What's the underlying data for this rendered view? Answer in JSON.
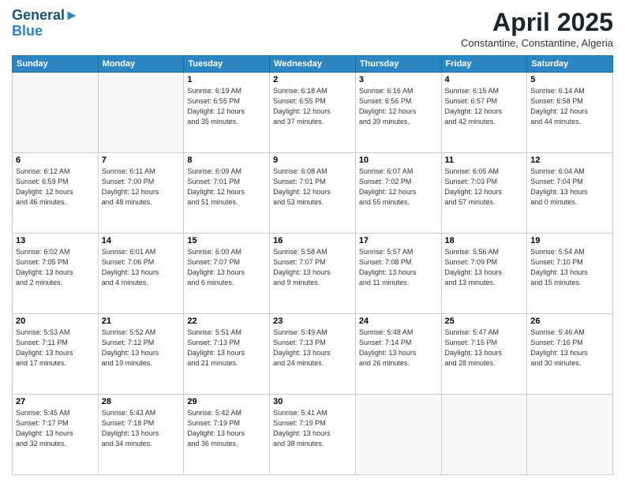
{
  "header": {
    "logo_line1": "General",
    "logo_line2": "Blue",
    "month": "April 2025",
    "location": "Constantine, Constantine, Algeria"
  },
  "days_of_week": [
    "Sunday",
    "Monday",
    "Tuesday",
    "Wednesday",
    "Thursday",
    "Friday",
    "Saturday"
  ],
  "weeks": [
    [
      {
        "day": "",
        "info": ""
      },
      {
        "day": "",
        "info": ""
      },
      {
        "day": "1",
        "info": "Sunrise: 6:19 AM\nSunset: 6:55 PM\nDaylight: 12 hours\nand 35 minutes."
      },
      {
        "day": "2",
        "info": "Sunrise: 6:18 AM\nSunset: 6:55 PM\nDaylight: 12 hours\nand 37 minutes."
      },
      {
        "day": "3",
        "info": "Sunrise: 6:16 AM\nSunset: 6:56 PM\nDaylight: 12 hours\nand 39 minutes."
      },
      {
        "day": "4",
        "info": "Sunrise: 6:15 AM\nSunset: 6:57 PM\nDaylight: 12 hours\nand 42 minutes."
      },
      {
        "day": "5",
        "info": "Sunrise: 6:14 AM\nSunset: 6:58 PM\nDaylight: 12 hours\nand 44 minutes."
      }
    ],
    [
      {
        "day": "6",
        "info": "Sunrise: 6:12 AM\nSunset: 6:59 PM\nDaylight: 12 hours\nand 46 minutes."
      },
      {
        "day": "7",
        "info": "Sunrise: 6:11 AM\nSunset: 7:00 PM\nDaylight: 12 hours\nand 48 minutes."
      },
      {
        "day": "8",
        "info": "Sunrise: 6:09 AM\nSunset: 7:01 PM\nDaylight: 12 hours\nand 51 minutes."
      },
      {
        "day": "9",
        "info": "Sunrise: 6:08 AM\nSunset: 7:01 PM\nDaylight: 12 hours\nand 53 minutes."
      },
      {
        "day": "10",
        "info": "Sunrise: 6:07 AM\nSunset: 7:02 PM\nDaylight: 12 hours\nand 55 minutes."
      },
      {
        "day": "11",
        "info": "Sunrise: 6:05 AM\nSunset: 7:03 PM\nDaylight: 12 hours\nand 57 minutes."
      },
      {
        "day": "12",
        "info": "Sunrise: 6:04 AM\nSunset: 7:04 PM\nDaylight: 13 hours\nand 0 minutes."
      }
    ],
    [
      {
        "day": "13",
        "info": "Sunrise: 6:02 AM\nSunset: 7:05 PM\nDaylight: 13 hours\nand 2 minutes."
      },
      {
        "day": "14",
        "info": "Sunrise: 6:01 AM\nSunset: 7:06 PM\nDaylight: 13 hours\nand 4 minutes."
      },
      {
        "day": "15",
        "info": "Sunrise: 6:00 AM\nSunset: 7:07 PM\nDaylight: 13 hours\nand 6 minutes."
      },
      {
        "day": "16",
        "info": "Sunrise: 5:58 AM\nSunset: 7:07 PM\nDaylight: 13 hours\nand 9 minutes."
      },
      {
        "day": "17",
        "info": "Sunrise: 5:57 AM\nSunset: 7:08 PM\nDaylight: 13 hours\nand 11 minutes."
      },
      {
        "day": "18",
        "info": "Sunrise: 5:56 AM\nSunset: 7:09 PM\nDaylight: 13 hours\nand 13 minutes."
      },
      {
        "day": "19",
        "info": "Sunrise: 5:54 AM\nSunset: 7:10 PM\nDaylight: 13 hours\nand 15 minutes."
      }
    ],
    [
      {
        "day": "20",
        "info": "Sunrise: 5:53 AM\nSunset: 7:11 PM\nDaylight: 13 hours\nand 17 minutes."
      },
      {
        "day": "21",
        "info": "Sunrise: 5:52 AM\nSunset: 7:12 PM\nDaylight: 13 hours\nand 19 minutes."
      },
      {
        "day": "22",
        "info": "Sunrise: 5:51 AM\nSunset: 7:13 PM\nDaylight: 13 hours\nand 21 minutes."
      },
      {
        "day": "23",
        "info": "Sunrise: 5:49 AM\nSunset: 7:13 PM\nDaylight: 13 hours\nand 24 minutes."
      },
      {
        "day": "24",
        "info": "Sunrise: 5:48 AM\nSunset: 7:14 PM\nDaylight: 13 hours\nand 26 minutes."
      },
      {
        "day": "25",
        "info": "Sunrise: 5:47 AM\nSunset: 7:15 PM\nDaylight: 13 hours\nand 28 minutes."
      },
      {
        "day": "26",
        "info": "Sunrise: 5:46 AM\nSunset: 7:16 PM\nDaylight: 13 hours\nand 30 minutes."
      }
    ],
    [
      {
        "day": "27",
        "info": "Sunrise: 5:45 AM\nSunset: 7:17 PM\nDaylight: 13 hours\nand 32 minutes."
      },
      {
        "day": "28",
        "info": "Sunrise: 5:43 AM\nSunset: 7:18 PM\nDaylight: 13 hours\nand 34 minutes."
      },
      {
        "day": "29",
        "info": "Sunrise: 5:42 AM\nSunset: 7:19 PM\nDaylight: 13 hours\nand 36 minutes."
      },
      {
        "day": "30",
        "info": "Sunrise: 5:41 AM\nSunset: 7:19 PM\nDaylight: 13 hours\nand 38 minutes."
      },
      {
        "day": "",
        "info": ""
      },
      {
        "day": "",
        "info": ""
      },
      {
        "day": "",
        "info": ""
      }
    ]
  ]
}
